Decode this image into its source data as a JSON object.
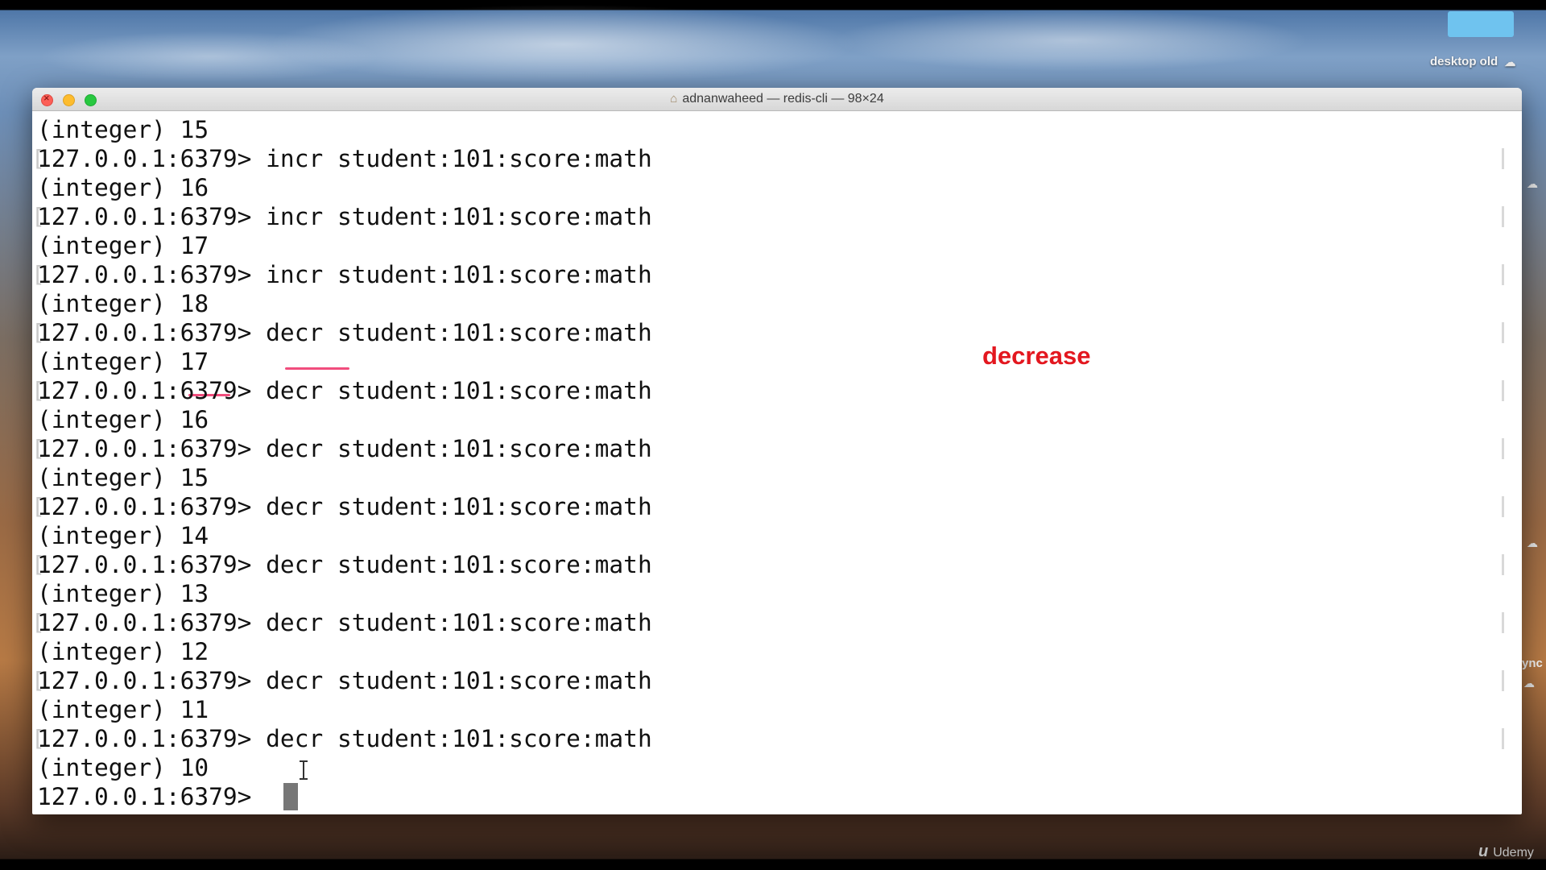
{
  "desktop": {
    "label": "desktop old",
    "sync_fragment": "ync",
    "watermark_logo": "u",
    "watermark_text": "Udemy"
  },
  "window": {
    "title": "adnanwaheed — redis-cli — 98×24"
  },
  "annotation": {
    "text": "decrease",
    "color": "#e3171f"
  },
  "terminal_lines": [
    "(integer) 15",
    "127.0.0.1:6379> incr student:101:score:math",
    "(integer) 16",
    "127.0.0.1:6379> incr student:101:score:math",
    "(integer) 17",
    "127.0.0.1:6379> incr student:101:score:math",
    "(integer) 18",
    "127.0.0.1:6379> decr student:101:score:math",
    "(integer) 17",
    "127.0.0.1:6379> decr student:101:score:math",
    "(integer) 16",
    "127.0.0.1:6379> decr student:101:score:math",
    "(integer) 15",
    "127.0.0.1:6379> decr student:101:score:math",
    "(integer) 14",
    "127.0.0.1:6379> decr student:101:score:math",
    "(integer) 13",
    "127.0.0.1:6379> decr student:101:score:math",
    "(integer) 12",
    "127.0.0.1:6379> decr student:101:score:math",
    "(integer) 11",
    "127.0.0.1:6379> decr student:101:score:math",
    "(integer) 10",
    "127.0.0.1:6379> "
  ],
  "colors": {
    "highlight_underline": "#f14d7d",
    "terminal_background": "#ffffff"
  }
}
